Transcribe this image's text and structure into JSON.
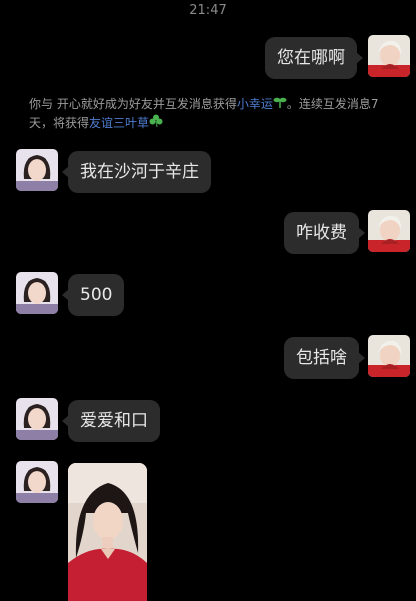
{
  "status_bar": {
    "time": "21:47"
  },
  "system_message": {
    "text_1": "你与 开心就好成为好友并互发消息获得",
    "badge_1": "小幸运",
    "text_2": "。连续互发消息7天，将获得",
    "badge_2": "友谊三叶草"
  },
  "messages": [
    {
      "side": "out",
      "text": "您在哪啊"
    },
    {
      "side": "in",
      "text": "我在沙河于辛庄"
    },
    {
      "side": "out",
      "text": "咋收费"
    },
    {
      "side": "in",
      "text": "500"
    },
    {
      "side": "out",
      "text": "包括啥"
    },
    {
      "side": "in",
      "text": "爱爱和口"
    },
    {
      "side": "in",
      "type": "image"
    }
  ],
  "colors": {
    "background": "#000000",
    "bubble": "#2c2c2c",
    "link": "#4f7ed0",
    "clover": "#49b24f"
  }
}
